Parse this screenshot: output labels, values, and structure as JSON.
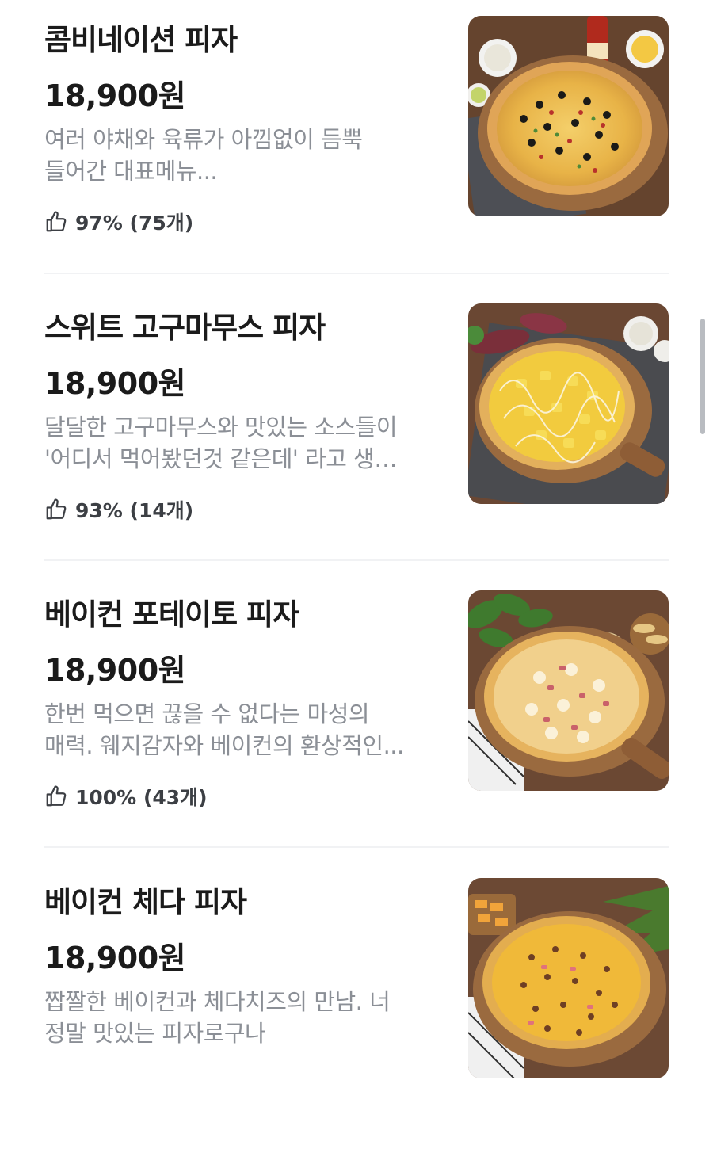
{
  "menu": {
    "items": [
      {
        "name": "콤비네이션 피자",
        "price": "18,900원",
        "description_line1": "여러 야채와 육류가 아낌없이 듬뿍",
        "description_line2": "들어간 대표메뉴...",
        "rating": "97% (75개)",
        "image_alt": "combination-pizza-photo"
      },
      {
        "name": "스위트 고구마무스 피자",
        "price": "18,900원",
        "description_line1": "달달한 고구마무스와 맛있는 소스들이",
        "description_line2": "'어디서 먹어봤던것 같은데' 라고 생…",
        "rating": "93% (14개)",
        "image_alt": "sweet-potato-mousse-pizza-photo"
      },
      {
        "name": "베이컨 포테이토 피자",
        "price": "18,900원",
        "description_line1": "한번 먹으면 끊을 수 없다는 마성의",
        "description_line2": "매력. 웨지감자와 베이컨의 환상적인...",
        "rating": "100% (43개)",
        "image_alt": "bacon-potato-pizza-photo"
      },
      {
        "name": "베이컨 체다 피자",
        "price": "18,900원",
        "description_line1": "짭짤한 베이컨과 체다치즈의 만남. 너",
        "description_line2": "정말 맛있는 피자로구나",
        "image_alt": "bacon-cheddar-pizza-photo"
      }
    ]
  },
  "icons": {
    "rating": "thumbs-up-icon"
  },
  "colors": {
    "title": "#1b1b1b",
    "description": "#8b8f96",
    "rating_text": "#3c3f44",
    "divider": "#f1f2f4",
    "scrollbar": "#b9bcc1"
  }
}
